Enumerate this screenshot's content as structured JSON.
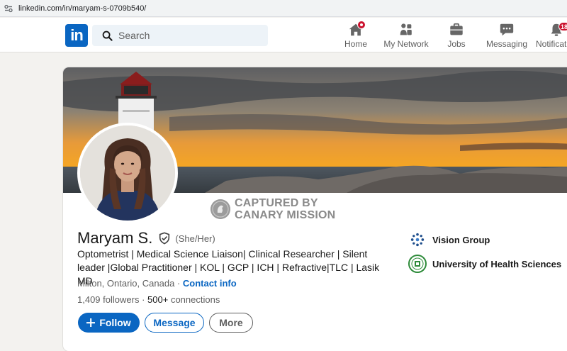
{
  "browser": {
    "url": "linkedin.com/in/maryam-s-0709b540/"
  },
  "nav": {
    "logo": "in",
    "search_placeholder": "Search",
    "items": [
      {
        "label": "Home",
        "icon": "home-icon",
        "badge": ""
      },
      {
        "label": "My Network",
        "icon": "network-icon"
      },
      {
        "label": "Jobs",
        "icon": "briefcase-icon"
      },
      {
        "label": "Messaging",
        "icon": "messaging-icon"
      },
      {
        "label": "Notifications",
        "icon": "bell-icon",
        "badge": "18"
      }
    ]
  },
  "profile": {
    "watermark_line1": "CAPTURED BY",
    "watermark_line2": "CANARY MISSION",
    "name": "Maryam S.",
    "pronouns": "(She/Her)",
    "headline": "Optometrist | Medical Science Liaison| Clinical Researcher | Silent leader |Global Practitioner | KOL | GCP | ICH | Refractive|TLC | Lasik MD",
    "location": "Milton, Ontario, Canada",
    "location_sep": " · ",
    "contact_info": "Contact info",
    "followers": "1,409",
    "followers_label": " followers",
    "stats_sep": " · ",
    "connections": "500+",
    "connections_label": " connections",
    "buttons": {
      "follow": "Follow",
      "message": "Message",
      "more": "More"
    },
    "organizations": [
      {
        "name": "Vision Group",
        "icon": "vision-group-logo"
      },
      {
        "name": "University of Health Sciences",
        "icon": "university-seal-logo"
      }
    ]
  },
  "colors": {
    "brand": "#0a66c2",
    "badge": "#cb112d",
    "watermark": "#8a8a8a"
  }
}
